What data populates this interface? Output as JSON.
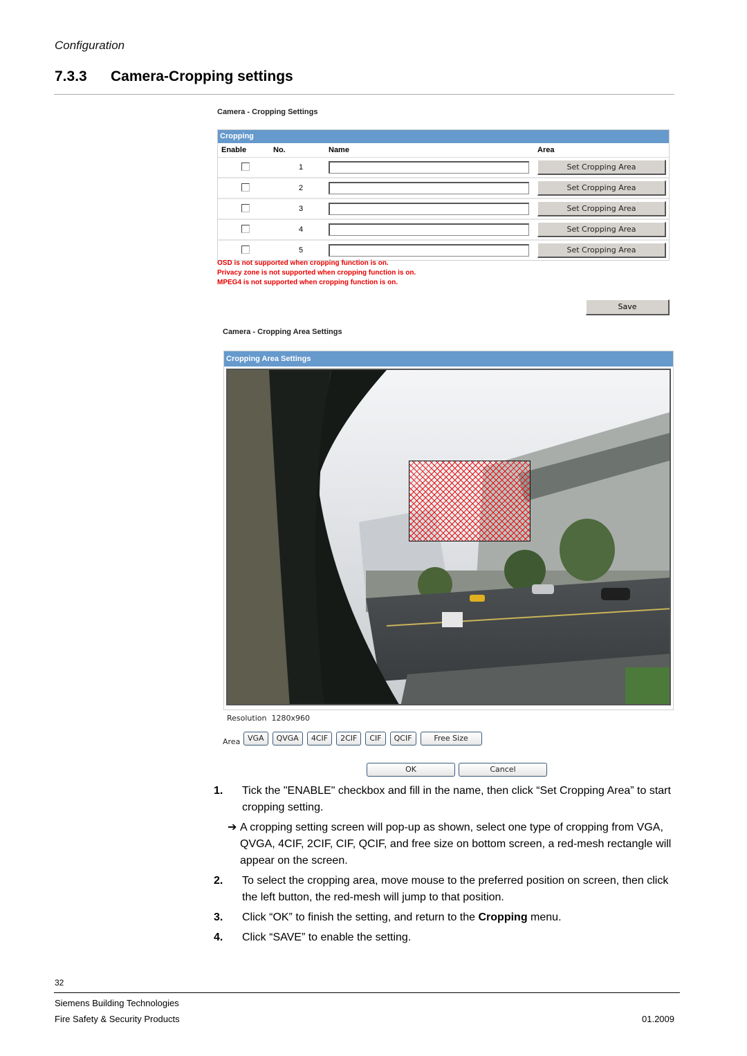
{
  "header": {
    "section": "Configuration",
    "heading_number": "7.3.3",
    "heading_title": "Camera-Cropping settings"
  },
  "cropping_settings": {
    "page_title": "Camera - Cropping Settings",
    "panel_title": "Cropping",
    "columns": [
      "Enable",
      "No.",
      "Name",
      "Area"
    ],
    "rows": [
      {
        "enabled": false,
        "no": "1",
        "name": "",
        "area_button": "Set Cropping Area"
      },
      {
        "enabled": false,
        "no": "2",
        "name": "",
        "area_button": "Set Cropping Area"
      },
      {
        "enabled": false,
        "no": "3",
        "name": "",
        "area_button": "Set Cropping Area"
      },
      {
        "enabled": false,
        "no": "4",
        "name": "",
        "area_button": "Set Cropping Area"
      },
      {
        "enabled": false,
        "no": "5",
        "name": "",
        "area_button": "Set Cropping Area"
      }
    ],
    "warnings": [
      "OSD is not supported when cropping function is on.",
      "Privacy zone is not supported when cropping function is on.",
      "MPEG4 is not supported when cropping function is on."
    ],
    "save_label": "Save",
    "colors": {
      "panel_bar": "#6699cc",
      "warning": "#e60000"
    }
  },
  "cropping_area": {
    "page_title": "Camera - Cropping Area Settings",
    "panel_title": "Cropping Area Settings",
    "camera_view": "live-camera-image",
    "resolution_label": "Resolution",
    "resolution_value": "1280x960",
    "area_label": "Area",
    "size_buttons": [
      "VGA",
      "QVGA",
      "4CIF",
      "2CIF",
      "CIF",
      "QCIF",
      "Free Size"
    ],
    "ok_label": "OK",
    "cancel_label": "Cancel"
  },
  "instructions": {
    "step1_num": "1.",
    "step1": "Tick the \"ENABLE\" checkbox and fill in the name, then click “Set Cropping Area” to start cropping setting.",
    "arrow": "➔",
    "arrow_text": "A cropping setting screen will pop-up as shown, select one type of cropping from VGA, QVGA, 4CIF, 2CIF, CIF, QCIF, and free size on bottom screen, a red-mesh rectangle will appear on the screen.",
    "step2_num": "2.",
    "step2": "To select the cropping area, move mouse to the preferred position on screen, then click the left button, the red-mesh will jump to that position.",
    "step3_num": "3.",
    "step3_pre": "Click “OK” to finish the setting, and return to the ",
    "step3_bold": "Cropping",
    "step3_post": " menu.",
    "step4_num": "4.",
    "step4": "Click “SAVE” to enable the setting."
  },
  "footer": {
    "page_number": "32",
    "company": "Siemens Building Technologies",
    "division": "Fire Safety & Security Products",
    "date": "01.2009"
  }
}
